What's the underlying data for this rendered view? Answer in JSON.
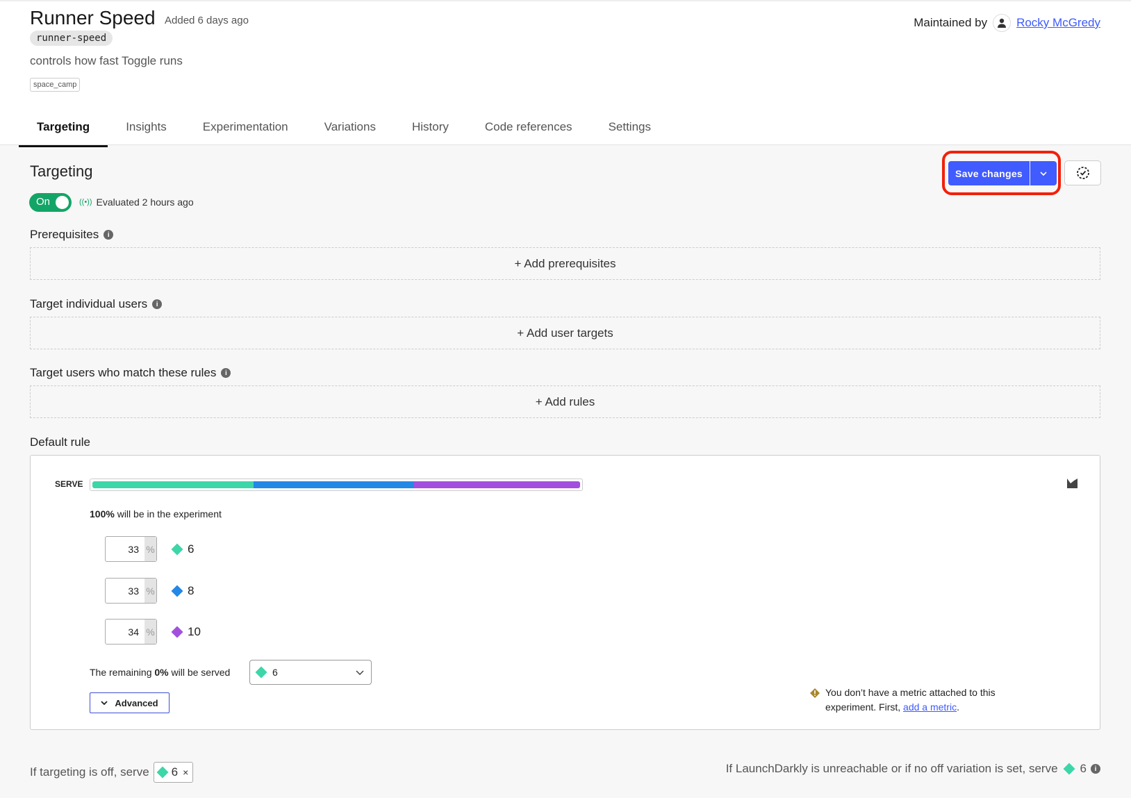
{
  "flag": {
    "title": "Runner Speed",
    "added": "Added 6 days ago",
    "key": "runner-speed",
    "description": "controls how fast Toggle runs",
    "tag": "space_camp"
  },
  "maintainer": {
    "label": "Maintained by",
    "name": "Rocky McGredy"
  },
  "tabs": [
    "Targeting",
    "Insights",
    "Experimentation",
    "Variations",
    "History",
    "Code references",
    "Settings"
  ],
  "targeting": {
    "heading": "Targeting",
    "toggle": "On",
    "toggle_on": true,
    "evaluated": "Evaluated 2 hours ago",
    "save": "Save changes"
  },
  "sections": {
    "prereq": {
      "label": "Prerequisites",
      "action": "+ Add prerequisites"
    },
    "individual": {
      "label": "Target individual users",
      "action": "+ Add user targets"
    },
    "rules": {
      "label": "Target users who match these rules",
      "action": "+ Add rules"
    },
    "default": {
      "label": "Default rule"
    }
  },
  "default_rule": {
    "serve": "SERVE",
    "experiment_pct": "100%",
    "experiment_text": " will be in the experiment",
    "variations": [
      {
        "percent": "33",
        "unit": "%",
        "value": "6",
        "color": "#3dd6a8"
      },
      {
        "percent": "33",
        "unit": "%",
        "value": "8",
        "color": "#2388e6"
      },
      {
        "percent": "34",
        "unit": "%",
        "value": "10",
        "color": "#a34fde"
      }
    ],
    "remaining_pre": "The remaining ",
    "remaining_pct": "0%",
    "remaining_post": " will be served",
    "remaining_value": "6",
    "advanced": "Advanced",
    "warning": "You don’t have a metric attached to this experiment. First, ",
    "warning_link": "add a metric",
    "warning_end": "."
  },
  "footer": {
    "off_label": "If targeting is off, serve",
    "off_value": "6",
    "fallback_label": "If LaunchDarkly is unreachable or if no off variation is set, serve",
    "fallback_value": "6"
  },
  "colors": {
    "accent": "#405bff",
    "highlight": "#f2200a",
    "toggle": "#13a567"
  }
}
